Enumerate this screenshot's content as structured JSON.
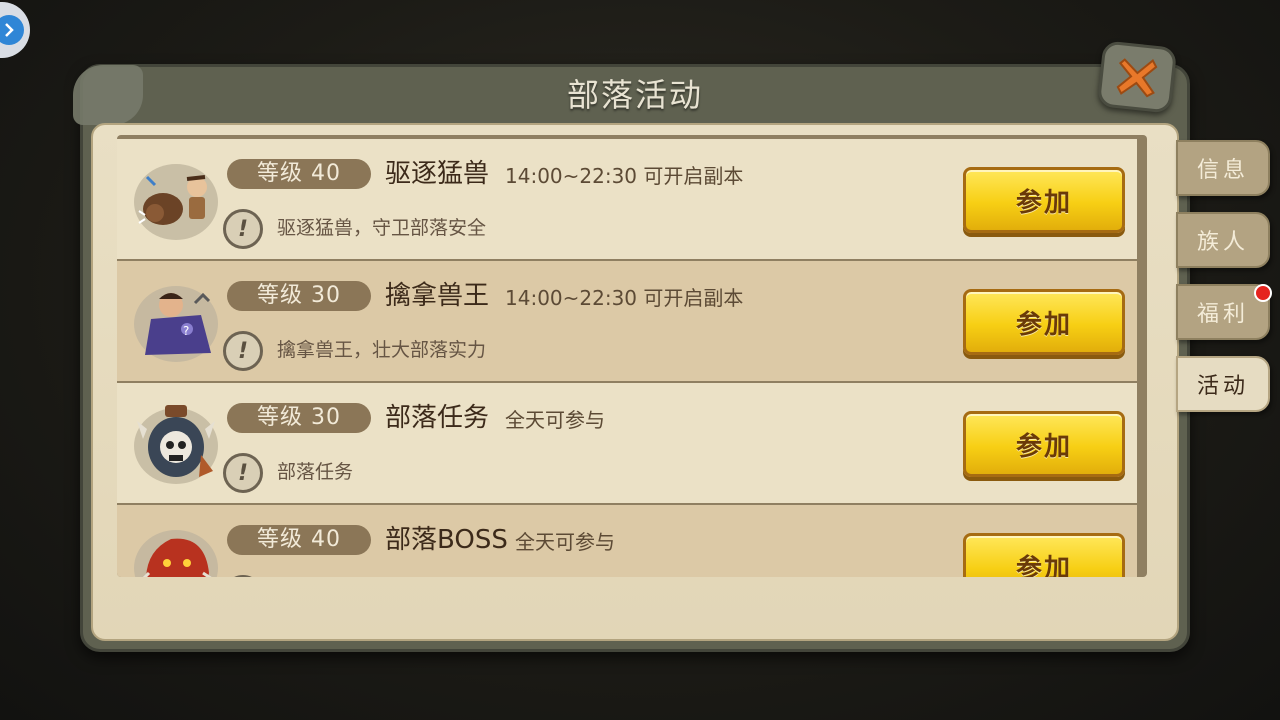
{
  "panel": {
    "title": "部落活动"
  },
  "tabs": [
    {
      "label": "信息",
      "active": false,
      "badge": false
    },
    {
      "label": "族人",
      "active": false,
      "badge": false
    },
    {
      "label": "福利",
      "active": false,
      "badge": true
    },
    {
      "label": "活动",
      "active": true,
      "badge": false
    }
  ],
  "activities": [
    {
      "level": "等级 40",
      "name": "驱逐猛兽",
      "time": "14:00~22:30 可开启副本",
      "desc": "驱逐猛兽，守卫部落安全",
      "button": "参加",
      "icon": "boar-hunt-icon"
    },
    {
      "level": "等级 30",
      "name": "擒拿兽王",
      "time": "14:00~22:30 可开启副本",
      "desc": "擒拿兽王，壮大部落实力",
      "button": "参加",
      "icon": "beast-king-icon"
    },
    {
      "level": "等级 30",
      "name": "部落任务",
      "time": "全天可参与",
      "desc": "部落任务",
      "button": "参加",
      "icon": "skull-mask-icon"
    },
    {
      "level": "等级 40",
      "name": "部落BOSS",
      "time": "全天可参与",
      "desc": "",
      "button": "参加",
      "icon": "boss-monster-icon"
    }
  ],
  "colors": {
    "button_yellow": "#f7cf14",
    "badge_red": "#e5241f",
    "parchment": "#e9dfc4"
  }
}
